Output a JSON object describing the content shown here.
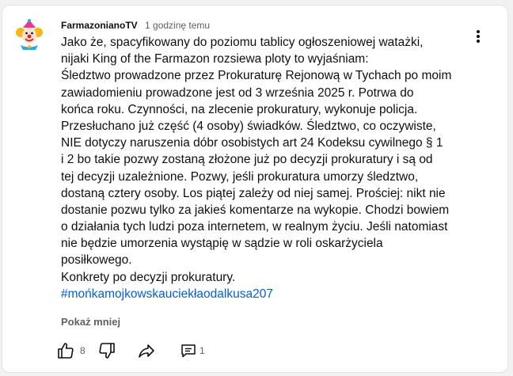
{
  "comment": {
    "author": "FarmazonianoTV",
    "time": "1 godzinę temu",
    "lines": [
      "Jako że, spacyfikowany do poziomu tablicy ogłoszeniowej watażki,",
      "nijaki King of the Farmazon rozsiewa ploty to wyjaśniam:",
      "Śledztwo prowadzone przez Prokuraturę Rejonową w Tychach po moim",
      "zawiadomieniu prowadzone jest od 3 września 2025 r.  Potrwa do",
      "końca roku. Czynności, na zlecenie prokuratury, wykonuje policja.",
      "Przesłuchano już część  (4 osoby) świadków. Śledztwo, co oczywiste,",
      "NIE dotyczy naruszenia dóbr osobistych art  24 Kodeksu cywilnego § 1",
      "i 2  bo takie pozwy zostaną złożone już po decyzji prokuratury i są od",
      "tej decyzji uzależnione. Pozwy, jeśli prokuratura umorzy śledztwo,",
      "dostaną cztery osoby. Los piątej zależy od niej samej. Prościej: nikt nie",
      "dostanie pozwu tylko za jakieś komentarze na wykopie. Chodzi bowiem",
      "o działania tych ludzi poza internetem, w realnym życiu. Jeśli natomiast",
      "nie będzie umorzenia wystąpię w sądzie w roli oskarżyciela",
      "posiłkowego.",
      "Konkrety po decyzji prokuratury."
    ],
    "hashtag": "#mońkamojkowskauciekłaodalkusa207",
    "show_less": "Pokaż mniej",
    "likes": "8",
    "replies": "1"
  },
  "icons": {
    "avatar": "clown-avatar",
    "more": "three-dots-vertical-icon",
    "like": "thumbs-up-icon",
    "dislike": "thumbs-down-icon",
    "share": "share-arrow-icon",
    "reply": "comment-icon"
  },
  "colors": {
    "text": "#0f0f0f",
    "secondary": "#606060",
    "link": "#065fd4"
  }
}
